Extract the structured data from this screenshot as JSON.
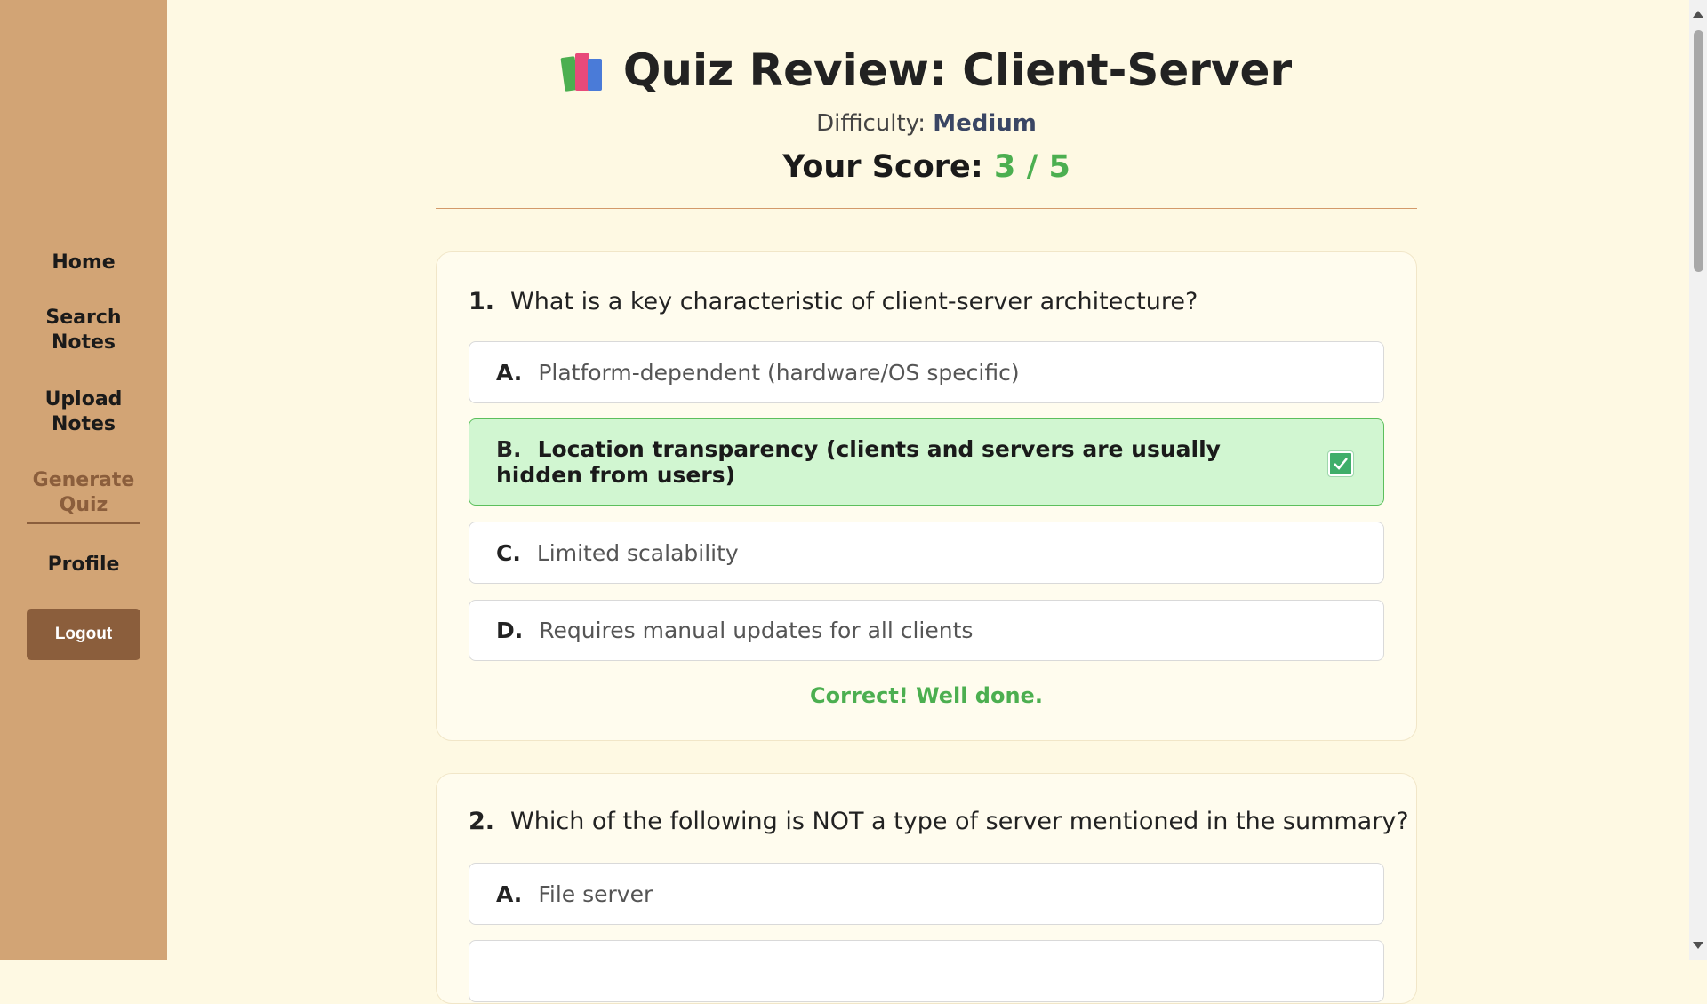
{
  "sidebar": {
    "items": [
      {
        "label": "Home"
      },
      {
        "label": "Search Notes"
      },
      {
        "label": "Upload Notes"
      },
      {
        "label": "Generate Quiz",
        "active": true
      },
      {
        "label": "Profile"
      }
    ],
    "logout_label": "Logout"
  },
  "header": {
    "icon": "books-icon",
    "title": "Quiz Review: Client-Server",
    "difficulty_label": "Difficulty:",
    "difficulty_value": "Medium",
    "score_label": "Your Score:",
    "score_value": "3 / 5"
  },
  "questions": [
    {
      "number": "1.",
      "text": "What is a key characteristic of client-server architecture?",
      "options": [
        {
          "letter": "A.",
          "text": "Platform-dependent (hardware/OS specific)"
        },
        {
          "letter": "B.",
          "text": "Location transparency (clients and servers are usually hidden from users)",
          "state": "correct"
        },
        {
          "letter": "C.",
          "text": "Limited scalability"
        },
        {
          "letter": "D.",
          "text": "Requires manual updates for all clients"
        }
      ],
      "feedback": "Correct! Well done."
    },
    {
      "number": "2.",
      "text": "Which of the following is NOT a type of server mentioned in the summary?",
      "options": [
        {
          "letter": "A.",
          "text": "File server"
        }
      ]
    }
  ],
  "colors": {
    "sidebar_bg": "#D2A475",
    "page_bg": "#FEF9E3",
    "accent_brown": "#8B5E3C",
    "correct_green": "#4CAF50",
    "correct_bg": "#D1F6D1"
  }
}
